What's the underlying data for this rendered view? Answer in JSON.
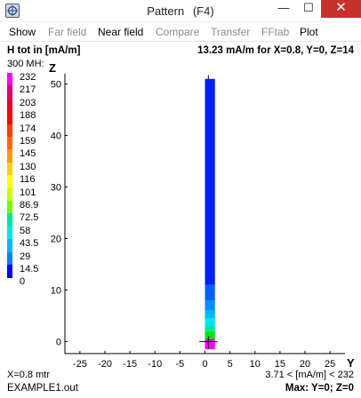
{
  "window": {
    "title": "Pattern",
    "title_key": "(F4)",
    "minimize_glyph": "—",
    "maximize_glyph": "☐",
    "close_glyph": "✕",
    "icon": "app-pattern-icon"
  },
  "menu": [
    {
      "label": "Show",
      "enabled": true
    },
    {
      "label": "Far field",
      "enabled": false
    },
    {
      "label": "Near field",
      "enabled": true
    },
    {
      "label": "Compare",
      "enabled": false
    },
    {
      "label": "Transfer",
      "enabled": false
    },
    {
      "label": "FFtab",
      "enabled": false
    },
    {
      "label": "Plot",
      "enabled": true
    }
  ],
  "header": {
    "left": "H tot in [mA/m]",
    "right": "13.23 mA/m for X=0.8, Y=0, Z=14",
    "scale_top": "300 MH:"
  },
  "legend": {
    "labels": [
      "232",
      "217",
      "203",
      "188",
      "174",
      "159",
      "145",
      "130",
      "116",
      "101",
      "86.9",
      "72.5",
      "58",
      "43.5",
      "29",
      "14.5",
      "0"
    ],
    "colors": [
      "#ff00ff",
      "#e0006f",
      "#e40032",
      "#ff0000",
      "#ff4000",
      "#ff6a00",
      "#ff9900",
      "#ffd000",
      "#ffff00",
      "#c8ff00",
      "#73ff00",
      "#00e6a0",
      "#00e6e6",
      "#00b8ff",
      "#0080ff",
      "#0000ff"
    ]
  },
  "chart_data": {
    "type": "heatmap",
    "title": "",
    "xlabel": "Y",
    "ylabel": "Z",
    "xlim": [
      -28,
      28
    ],
    "ylim": [
      -2,
      52
    ],
    "x_ticks": [
      -25,
      -20,
      -15,
      -10,
      -5,
      0,
      5,
      10,
      15,
      20,
      25
    ],
    "y_ticks": [
      0,
      10,
      20,
      30,
      40,
      50
    ],
    "column": {
      "y_from": 0,
      "y_to": 2,
      "cells": [
        {
          "z_from": -1.5,
          "z_to": 0.5,
          "color": "#ff00ff"
        },
        {
          "z_from": 0.5,
          "z_to": 2,
          "color": "#00e600"
        },
        {
          "z_from": 2,
          "z_to": 3,
          "color": "#00e6a0"
        },
        {
          "z_from": 3,
          "z_to": 4.5,
          "color": "#00e6e6"
        },
        {
          "z_from": 4.5,
          "z_to": 6,
          "color": "#00b8ff"
        },
        {
          "z_from": 6,
          "z_to": 8,
          "color": "#0090ff"
        },
        {
          "z_from": 8,
          "z_to": 11,
          "color": "#0060ff"
        },
        {
          "z_from": 11,
          "z_to": 51,
          "color": "#0020ee"
        }
      ]
    },
    "marker": {
      "y": 0.5,
      "z": 0
    }
  },
  "footer": {
    "scale_unit": "X=0.8 mtr",
    "filename": "EXAMPLE1.out",
    "range": "3.71 < [mA/m] < 232",
    "max_info": "Max: Y=0; Z=0"
  }
}
